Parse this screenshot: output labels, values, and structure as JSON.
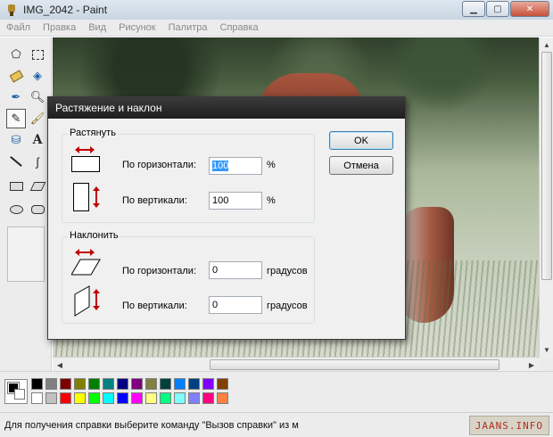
{
  "window": {
    "title": "IMG_2042 - Paint",
    "controls": {
      "minimize": "minimize-icon",
      "maximize": "maximize-icon",
      "close": "close-icon"
    }
  },
  "menu": [
    "Файл",
    "Правка",
    "Вид",
    "Рисунок",
    "Палитра",
    "Справка"
  ],
  "tools": [
    "free-select-icon",
    "rect-select-icon",
    "eraser-icon",
    "fill-bucket-icon",
    "color-picker-icon",
    "magnifier-icon",
    "pencil-icon",
    "brush-icon",
    "airbrush-icon",
    "text-icon",
    "line-icon",
    "curve-icon",
    "rectangle-icon",
    "polygon-icon",
    "ellipse-icon",
    "rounded-rect-icon"
  ],
  "dialog": {
    "title": "Растяжение и наклон",
    "stretch": {
      "label": "Растянуть",
      "horizontal_label": "По горизонтали:",
      "horizontal_value": "100",
      "vertical_label": "По вертикали:",
      "vertical_value": "100",
      "unit": "%"
    },
    "skew": {
      "label": "Наклонить",
      "horizontal_label": "По горизонтали:",
      "horizontal_value": "0",
      "vertical_label": "По вертикали:",
      "vertical_value": "0",
      "unit": "градусов"
    },
    "ok_label": "OK",
    "cancel_label": "Отмена"
  },
  "palette": {
    "foreground": "#000000",
    "background": "#ffffff",
    "row1": [
      "#000000",
      "#808080",
      "#800000",
      "#808000",
      "#008000",
      "#008080",
      "#000080",
      "#800080",
      "#808040",
      "#004040",
      "#0080ff",
      "#004080",
      "#8000ff",
      "#804000"
    ],
    "row2": [
      "#ffffff",
      "#c0c0c0",
      "#ff0000",
      "#ffff00",
      "#00ff00",
      "#00ffff",
      "#0000ff",
      "#ff00ff",
      "#ffff80",
      "#00ff80",
      "#80ffff",
      "#8080ff",
      "#ff0080",
      "#ff8040"
    ]
  },
  "status": {
    "text": "Для получения справки выберите команду \"Вызов справки\" из м",
    "watermark": "JAANS.INFO"
  }
}
